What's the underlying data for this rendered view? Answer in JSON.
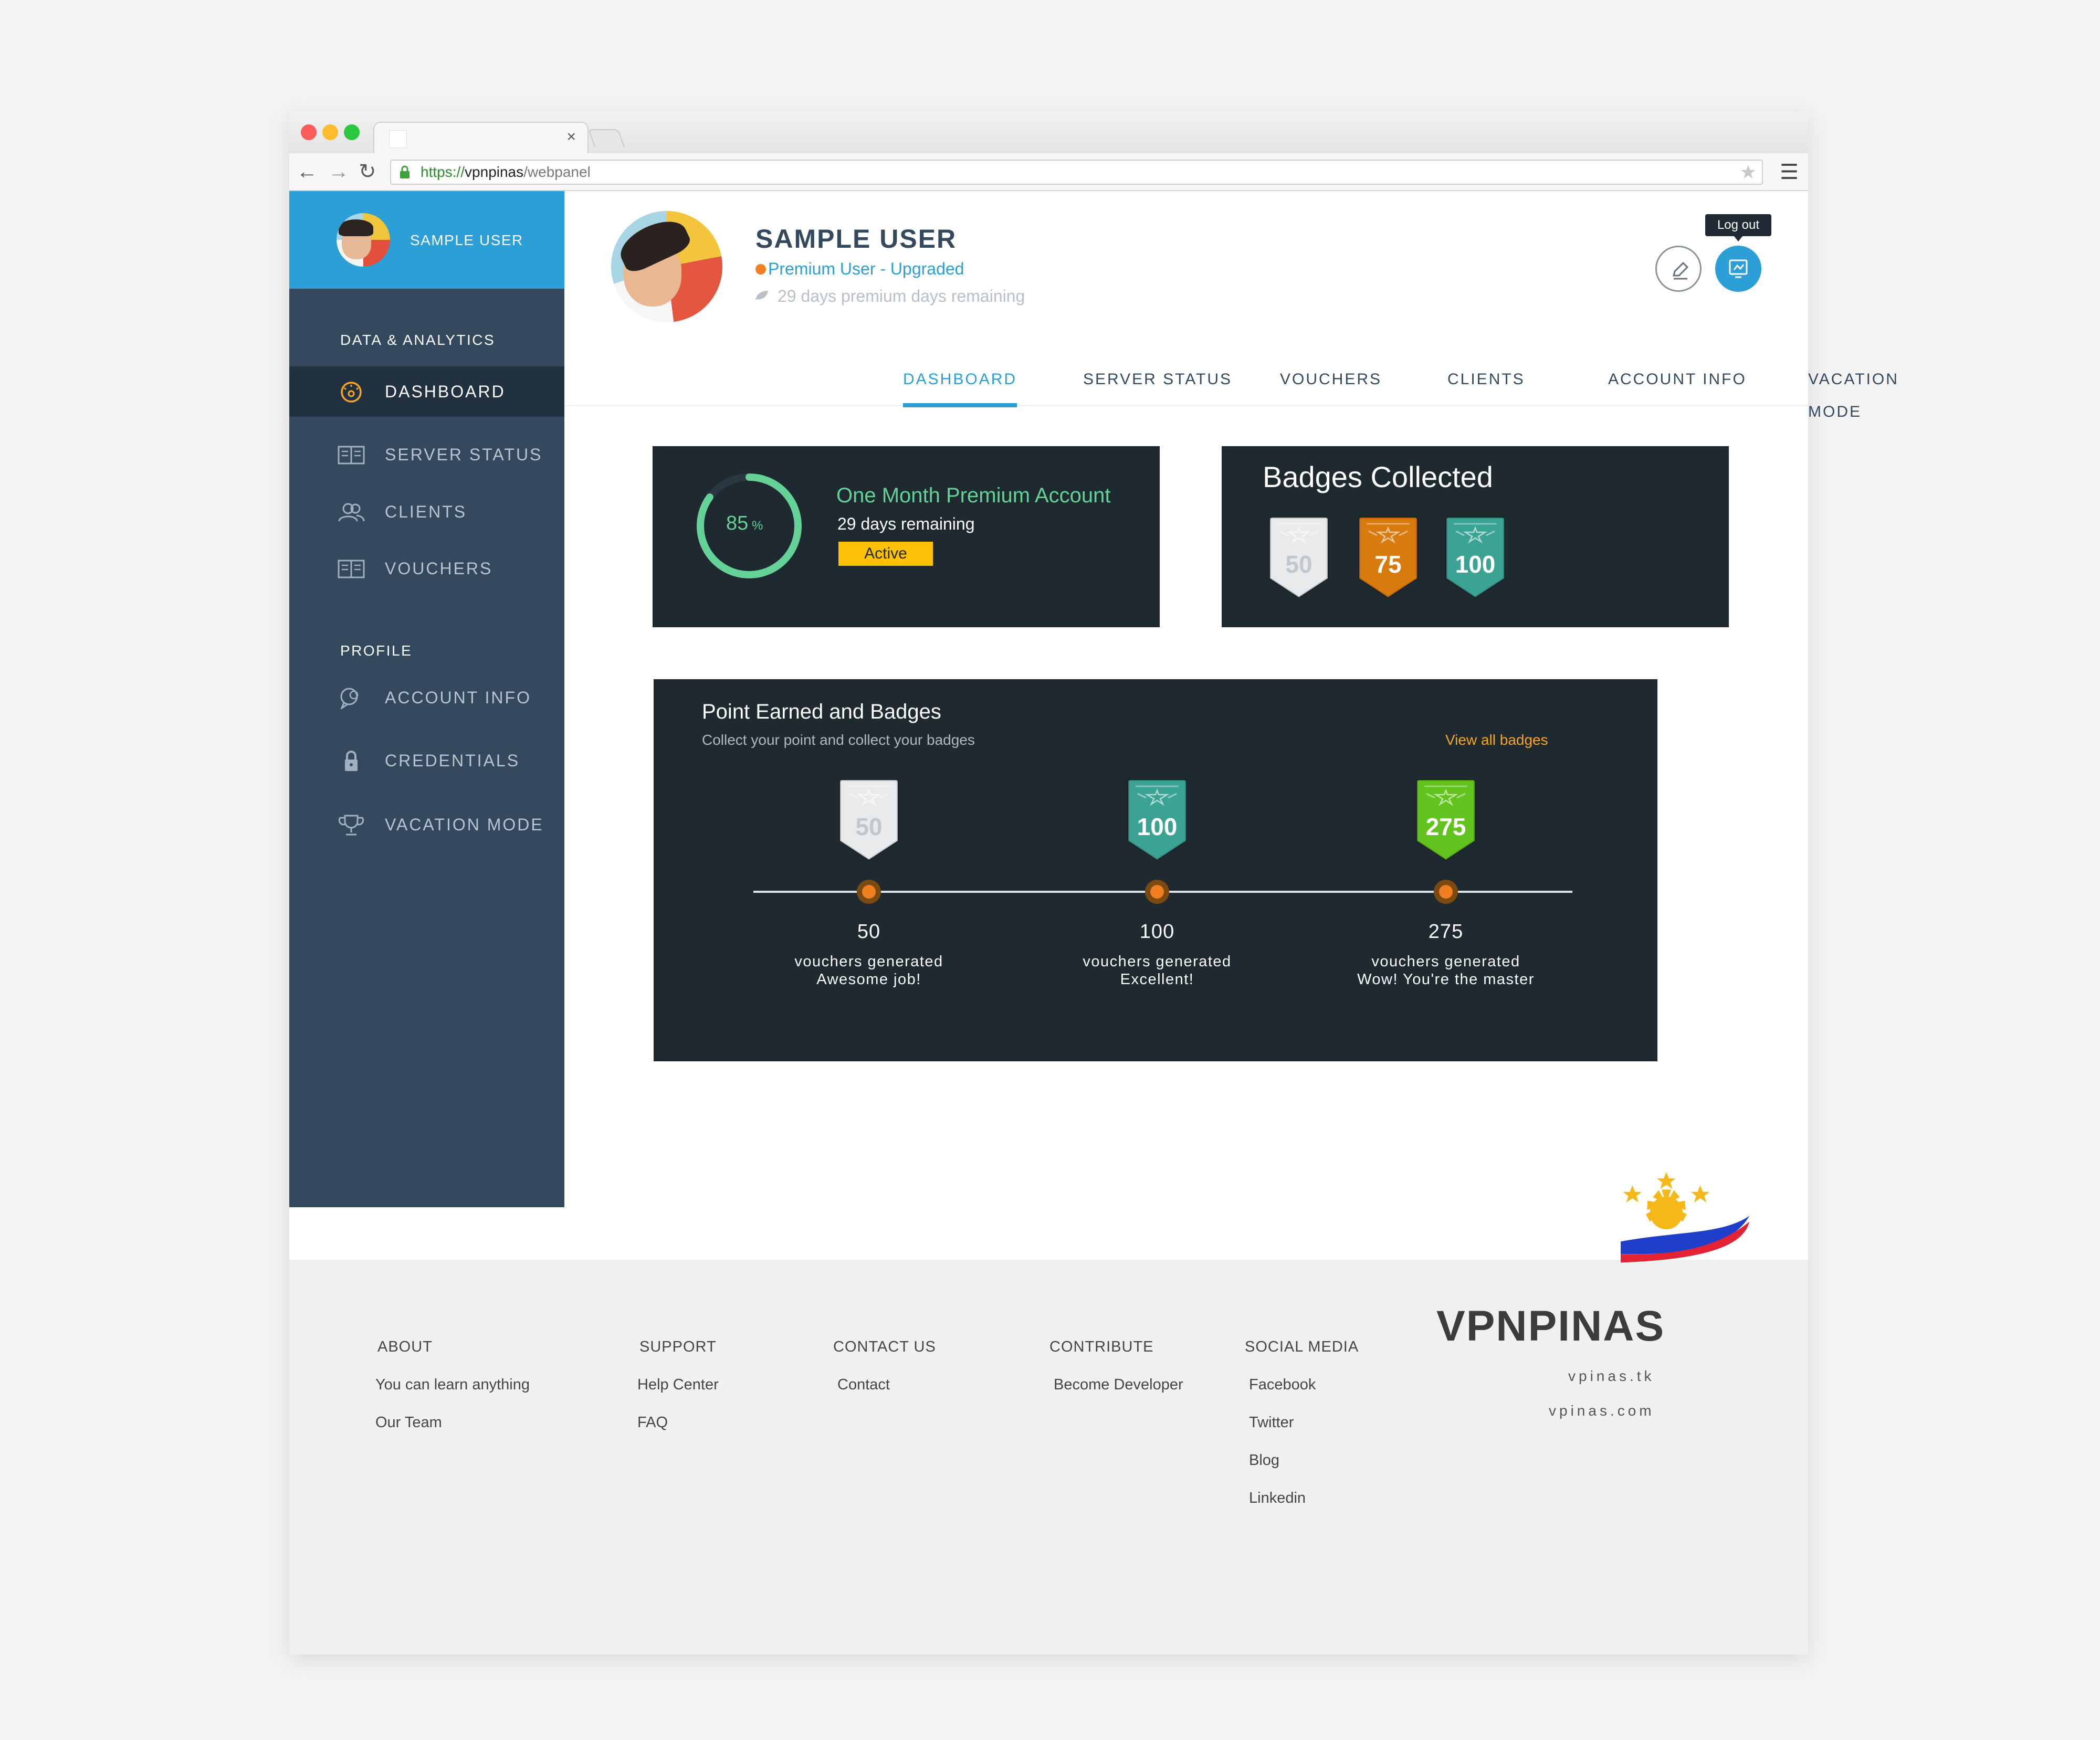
{
  "browser": {
    "url_scheme": "https://",
    "url_host": "vpnpinas",
    "url_path": "/webpanel",
    "tab_close": "×"
  },
  "sidebar": {
    "user_name": "SAMPLE USER",
    "sections": [
      {
        "title": "DATA & ANALYTICS",
        "items": [
          {
            "label": "DASHBOARD",
            "icon": "speedometer-icon",
            "active": true
          },
          {
            "label": "SERVER STATUS",
            "icon": "book-icon"
          },
          {
            "label": "CLIENTS",
            "icon": "users-icon"
          },
          {
            "label": "VOUCHERS",
            "icon": "book-icon"
          }
        ]
      },
      {
        "title": "PROFILE",
        "items": [
          {
            "label": "ACCOUNT INFO",
            "icon": "chat-icon"
          },
          {
            "label": "CREDENTIALS",
            "icon": "lock-icon"
          },
          {
            "label": "VACATION MODE",
            "icon": "trophy-icon"
          }
        ]
      }
    ]
  },
  "profile": {
    "name": "SAMPLE USER",
    "status": "Premium User - Upgraded",
    "days": "29 days premium days remaining",
    "logout_tooltip": "Log out"
  },
  "tabs": [
    {
      "label": "DASHBOARD",
      "active": true
    },
    {
      "label": "SERVER STATUS"
    },
    {
      "label": "VOUCHERS"
    },
    {
      "label": "CLIENTS"
    },
    {
      "label": "ACCOUNT INFO"
    },
    {
      "label": "VACATION MODE"
    }
  ],
  "plan": {
    "progress_value": "85",
    "progress_unit": "%",
    "progress_fraction": 0.85,
    "title": "One Month Premium Account",
    "days": "29 days remaining",
    "badge": "Active"
  },
  "badges": {
    "title": "Badges Collected",
    "items": [
      {
        "value": "50",
        "color": "#e8eaec",
        "text_color": "#c2c7cc"
      },
      {
        "value": "75",
        "color": "#d97a0e",
        "text_color": "#ffffff"
      },
      {
        "value": "100",
        "color": "#3aa394",
        "text_color": "#ffffff"
      }
    ]
  },
  "points": {
    "title": "Point Earned and Badges",
    "subtitle": "Collect your point and collect your badges",
    "link": "View all badges",
    "milestones": [
      {
        "badge": "50",
        "color": "#e8eaec",
        "text_color": "#c2c7cc",
        "number": "50",
        "line1": "vouchers generated",
        "line2": "Awesome job!"
      },
      {
        "badge": "100",
        "color": "#3aa394",
        "text_color": "#ffffff",
        "number": "100",
        "line1": "vouchers generated",
        "line2": "Excellent!"
      },
      {
        "badge": "275",
        "color": "#62c21e",
        "text_color": "#ffffff",
        "number": "275",
        "line1": "vouchers generated",
        "line2": "Wow! You're the master"
      }
    ]
  },
  "footer": {
    "columns": [
      {
        "title": "ABOUT",
        "links": [
          "You can learn anything",
          "Our Team"
        ]
      },
      {
        "title": "SUPPORT",
        "links": [
          "Help Center",
          "FAQ"
        ]
      },
      {
        "title": "CONTACT US",
        "links": [
          "Contact"
        ]
      },
      {
        "title": "CONTRIBUTE",
        "links": [
          "Become Developer"
        ]
      },
      {
        "title": "SOCIAL MEDIA",
        "links": [
          "Facebook",
          "Twitter",
          "Blog",
          "Linkedin"
        ]
      }
    ],
    "brand": "VPNPINAS",
    "site1": "vpinas.tk",
    "site2": "vpinas.com"
  },
  "colors": {
    "accent": "#2b9fd6",
    "sidebar": "#34495e",
    "card": "#1f2930",
    "success": "#64d196",
    "warning": "#ffc107"
  }
}
